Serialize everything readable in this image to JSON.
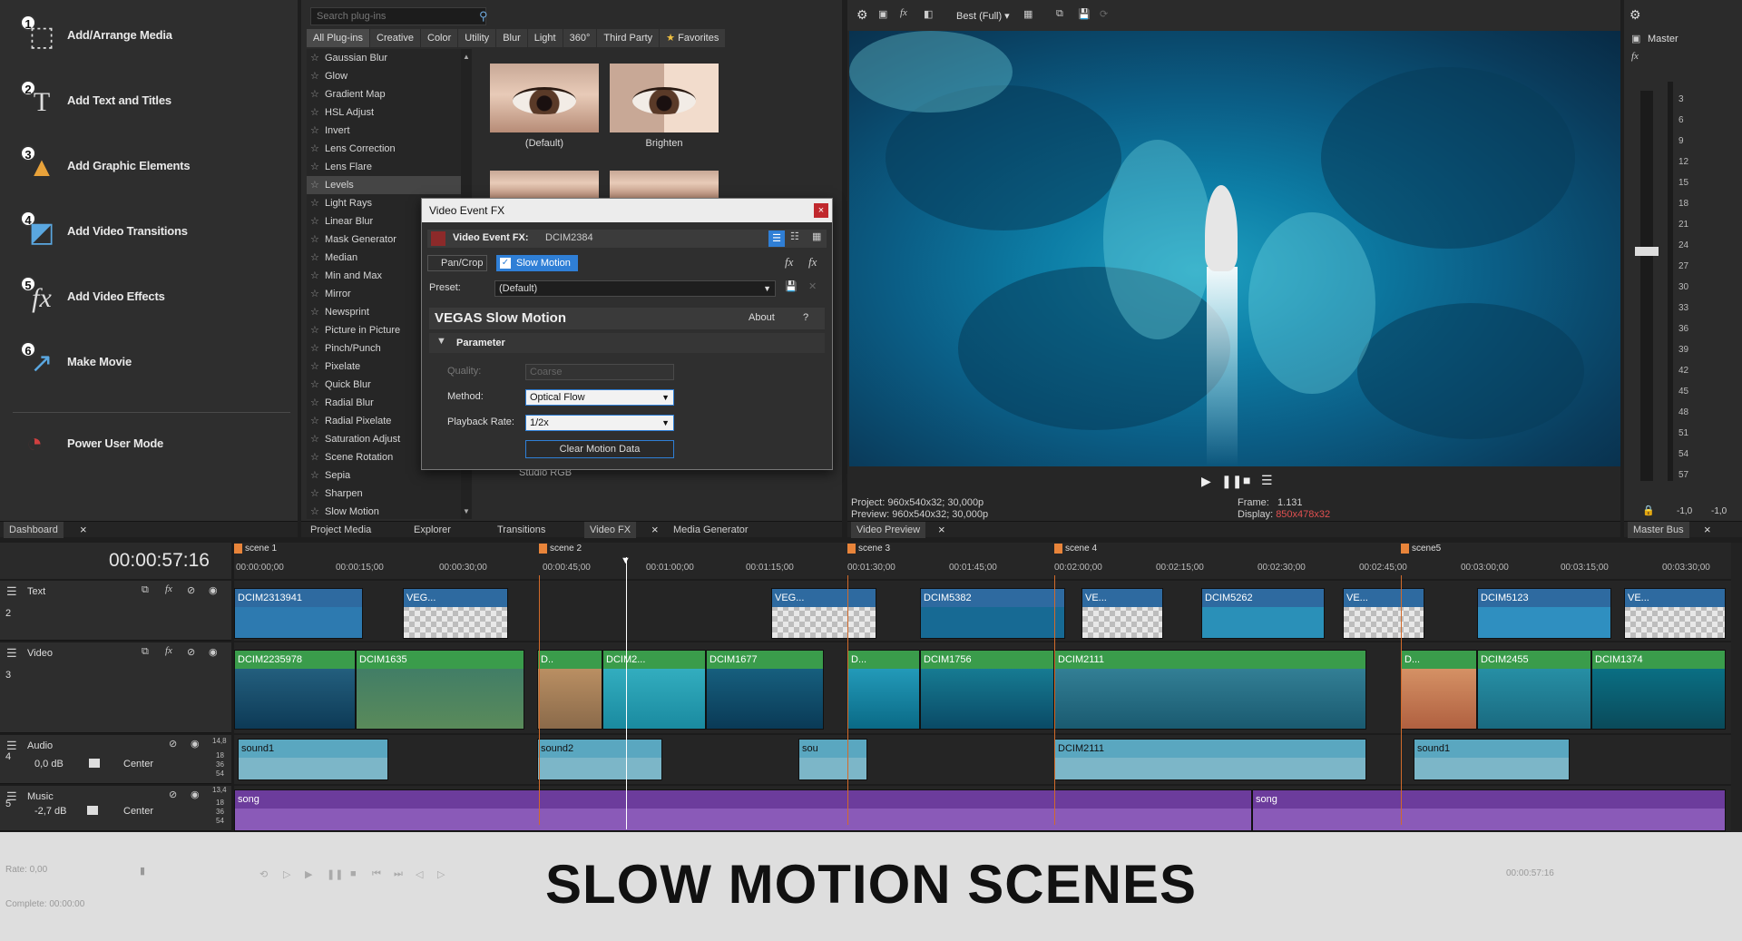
{
  "dashboard": {
    "items": [
      {
        "num": "1",
        "label": "Add/Arrange Media"
      },
      {
        "num": "2",
        "label": "Add Text and Titles"
      },
      {
        "num": "3",
        "label": "Add Graphic Elements"
      },
      {
        "num": "4",
        "label": "Add Video Transitions"
      },
      {
        "num": "5",
        "label": "Add Video Effects"
      },
      {
        "num": "6",
        "label": "Make Movie"
      }
    ],
    "power_user": "Power User Mode",
    "tab": "Dashboard"
  },
  "plugins": {
    "search_placeholder": "Search plug-ins",
    "categories": [
      "All Plug-ins",
      "Creative",
      "Color",
      "Utility",
      "Blur",
      "Light",
      "360°",
      "Third Party",
      "Favorites"
    ],
    "list": [
      "Gaussian Blur",
      "Glow",
      "Gradient Map",
      "HSL Adjust",
      "Invert",
      "Lens Correction",
      "Lens Flare",
      "Levels",
      "Light Rays",
      "Linear Blur",
      "Mask Generator",
      "Median",
      "Min and Max",
      "Mirror",
      "Newsprint",
      "Picture in Picture",
      "Pinch/Punch",
      "Pixelate",
      "Quick Blur",
      "Radial Blur",
      "Radial Pixelate",
      "Saturation Adjust",
      "Scene Rotation",
      "Sepia",
      "Sharpen",
      "Slow Motion"
    ],
    "selected": "Levels",
    "presets": [
      "(Default)",
      "Brighten"
    ],
    "studio_rgb": "Studio RGB",
    "tabs": [
      "Project Media",
      "Explorer",
      "Transitions",
      "Video FX",
      "Media Generator"
    ]
  },
  "fx_dialog": {
    "title": "Video Event FX",
    "fx_for_label": "Video Event FX:",
    "fx_for_value": "DCIM2384",
    "chain": [
      "Pan/Crop",
      "Slow Motion"
    ],
    "preset_label": "Preset:",
    "preset_value": "(Default)",
    "plugin_name": "VEGAS Slow Motion",
    "about": "About",
    "help": "?",
    "section": "Parameter",
    "quality_label": "Quality:",
    "quality_value": "Coarse",
    "method_label": "Method:",
    "method_value": "Optical Flow",
    "rate_label": "Playback Rate:",
    "rate_value": "1/2x",
    "clear_btn": "Clear Motion Data"
  },
  "preview": {
    "quality": "Best (Full)",
    "project_label": "Project:",
    "project_value": "960x540x32; 30,000p",
    "preview_label": "Preview:",
    "preview_value": "960x540x32; 30,000p",
    "frame_label": "Frame:",
    "frame_value": "1.131",
    "display_label": "Display:",
    "display_value": "850x478x32",
    "tab": "Video Preview"
  },
  "master": {
    "label": "Master",
    "ticks": [
      "3",
      "6",
      "9",
      "12",
      "15",
      "18",
      "21",
      "24",
      "27",
      "30",
      "33",
      "36",
      "39",
      "42",
      "45",
      "48",
      "51",
      "54",
      "57"
    ],
    "bottom_left": "-1,0",
    "bottom_right": "-1,0",
    "tab": "Master Bus"
  },
  "timeline": {
    "timecode": "00:00:57:16",
    "ruler": [
      "00:00:00;00",
      "00:00:15;00",
      "00:00:30;00",
      "00:00:45;00",
      "00:01:00;00",
      "00:01:15;00",
      "00:01:30;00",
      "00:01:45;00",
      "00:02:00;00",
      "00:02:15;00",
      "00:02:30;00",
      "00:02:45;00",
      "00:03:00;00",
      "00:03:15;00",
      "00:03:30;00"
    ],
    "markers": [
      "scene 1",
      "scene 2",
      "scene 3",
      "scene 4",
      "scene5"
    ],
    "tracks": [
      {
        "num": "2",
        "name": "Text"
      },
      {
        "num": "3",
        "name": "Video"
      },
      {
        "num": "4",
        "name": "Audio",
        "vol": "0,0 dB",
        "pan": "Center"
      },
      {
        "num": "5",
        "name": "Music",
        "vol": "-2,7 dB",
        "pan": "Center"
      }
    ],
    "text_clips": [
      "DCIM2313941",
      "VEG...",
      "VEG...",
      "DCIM5382",
      "VE...",
      "DCIM5262",
      "VE...",
      "DCIM5123",
      "VE..."
    ],
    "video_clips": [
      "DCIM2235978",
      "DCIM1635",
      "D..",
      "DCIM2...",
      "DCIM1677",
      "D...",
      "DCIM1756",
      "DCIM2111",
      "D...",
      "DCIM2455",
      "DCIM1374"
    ],
    "audio_clips": [
      "sound1",
      "sound2",
      "sou",
      "DCIM2111",
      "sound1"
    ],
    "music_clips": [
      "song",
      "song"
    ],
    "db_labels": [
      "14,8",
      "18",
      "36",
      "54",
      "13,4",
      "18",
      "36",
      "54"
    ]
  },
  "status": {
    "rate": "Rate: 0,00",
    "complete": "Complete: 00:00:00",
    "end_time": "00:00:57:16"
  },
  "overlay_title": "SLOW MOTION SCENES"
}
